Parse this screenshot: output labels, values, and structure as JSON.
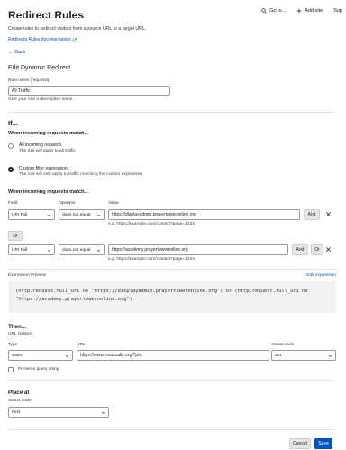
{
  "topbar": {
    "goto_label": "Go to...",
    "add_site_label": "Add site",
    "support_label": "Sup"
  },
  "header": {
    "title": "Redirect Rules",
    "description": "Create rules to redirect visitors from a source URL to a target URL.",
    "doc_link": "Redirects Rules documentation",
    "back_link": "Back"
  },
  "edit": {
    "heading": "Edit Dynamic Redirect",
    "rule_name_label": "Rule name (required)",
    "rule_name_value": "All Traffic",
    "rule_name_help": "Give your rule a descriptive name."
  },
  "if_section": {
    "heading": "If...",
    "match_heading": "When incoming requests match...",
    "options": [
      {
        "title": "All incoming requests",
        "desc": "The rule will apply to all traffic",
        "selected": false
      },
      {
        "title": "Custom filter expression",
        "desc": "The rule will only apply to traffic matching the custom expression",
        "selected": true
      }
    ]
  },
  "filter": {
    "heading": "When incoming requests match...",
    "col_field": "Field",
    "col_operator": "Operator",
    "col_value": "Value",
    "rows": [
      {
        "field": "URI Full",
        "operator": "does not equal",
        "value": "https://displayadmin.prayertoweronline.org",
        "hint": "e.g. https://example.com/contact?page=1234",
        "and": "And"
      },
      {
        "field": "URI Full",
        "operator": "does not equal",
        "value": "https://academy.prayertoweronline.org",
        "hint": "e.g. https://example.com/contact?page=1234",
        "and": "And",
        "or": "Or"
      }
    ],
    "or_label": "Or"
  },
  "expression": {
    "label": "Expression Preview",
    "edit_link": "Edit expression",
    "line1": "(http.request.full_uri ne \"https://displayadmin.prayertoweronline.org\") or (http.request.full_uri ne",
    "line2": "\"https://academy.prayertoweronline.org\")"
  },
  "then": {
    "heading": "Then...",
    "sub": "URL redirect",
    "type_label": "Type",
    "type_value": "Static",
    "url_label": "URL",
    "url_value": "https://www.jesuscalls.org/?pto",
    "status_label": "Status code",
    "status_value": "301",
    "preserve_label": "Preserve query string"
  },
  "place": {
    "heading": "Place at",
    "select_label": "Select order:",
    "select_value": "First"
  },
  "footer": {
    "cancel": "Cancel",
    "save": "Save"
  }
}
